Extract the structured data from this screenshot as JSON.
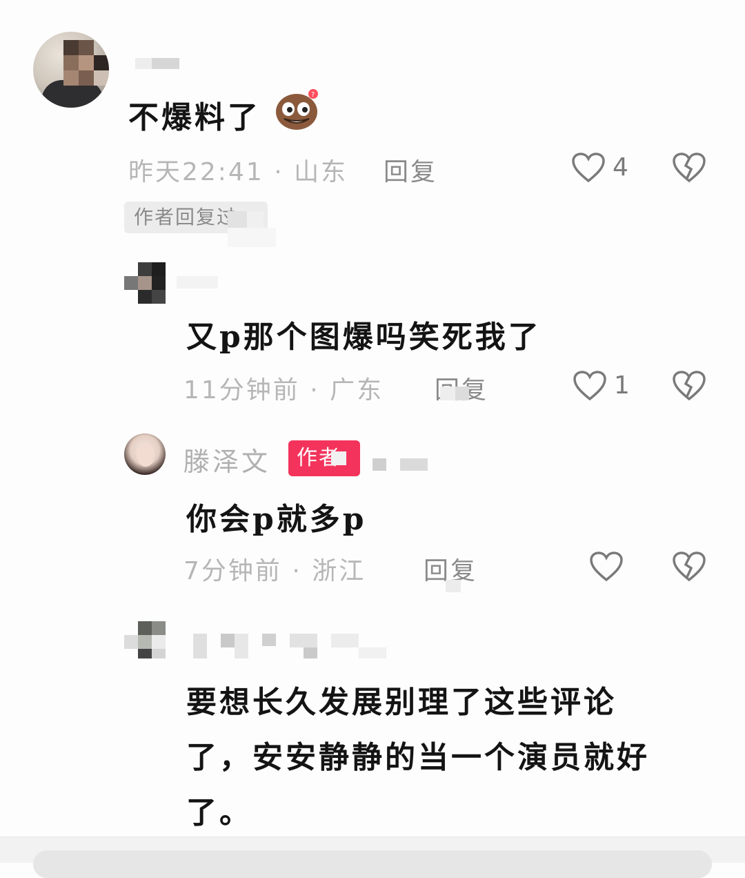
{
  "comments": [
    {
      "text": "不爆料了",
      "time": "昨天22:41",
      "sep": "·",
      "location": "山东",
      "reply_label": "回复",
      "likes": "4"
    },
    {
      "author_reply_tag": "作者回复过",
      "text": "又p那个图爆吗笑死我了",
      "time": "11分钟前",
      "sep": "·",
      "location": "广东",
      "reply_label": "回复",
      "likes": "1"
    },
    {
      "username": "滕泽文",
      "badge": "作者",
      "text": "你会p就多p",
      "time": "7分钟前",
      "sep": "·",
      "location": "浙江",
      "reply_label": "回复"
    },
    {
      "text_lines": [
        "要想长久发展别理了这些评论",
        "了，安安静静的当一个演员就好",
        "了。"
      ]
    }
  ],
  "colors": {
    "badge": "#f3335b",
    "meta": "#b6b6b6",
    "text": "#141414"
  },
  "icons": [
    "heart-icon",
    "broken-heart-icon"
  ]
}
